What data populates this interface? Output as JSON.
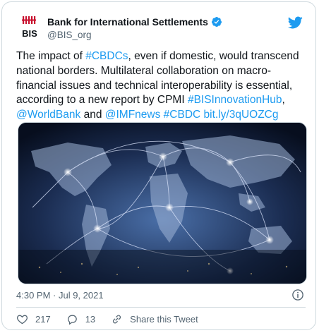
{
  "account": {
    "display_name": "Bank for International Settlements",
    "handle": "@BIS_org",
    "avatar_text": "BIS"
  },
  "tweet": {
    "segments": [
      {
        "text": "The impact of ",
        "link": false
      },
      {
        "text": "#CBDCs",
        "link": true
      },
      {
        "text": ", even if domestic, would transcend national borders. Multilateral collaboration on macro-financial issues and technical interoperability is essential, according to a new report by CPMI ",
        "link": false
      },
      {
        "text": "#BISInnovationHub",
        "link": true
      },
      {
        "text": ", ",
        "link": false
      },
      {
        "text": "@WorldBank",
        "link": true
      },
      {
        "text": " and ",
        "link": false
      },
      {
        "text": "@IMFnews",
        "link": true
      },
      {
        "text": " ",
        "link": false
      },
      {
        "text": "#CBDC",
        "link": true
      },
      {
        "text": " ",
        "link": false
      },
      {
        "text": "bit.ly/3qUOZCg",
        "link": true
      }
    ]
  },
  "meta": {
    "timestamp": "4:30 PM · Jul 9, 2021"
  },
  "actions": {
    "like_count": "217",
    "reply_count": "13",
    "share_label": "Share this Tweet"
  },
  "colors": {
    "accent": "#1d9bf0",
    "bis_red": "#c8102e",
    "text": "#0f1419",
    "muted": "#536471"
  }
}
